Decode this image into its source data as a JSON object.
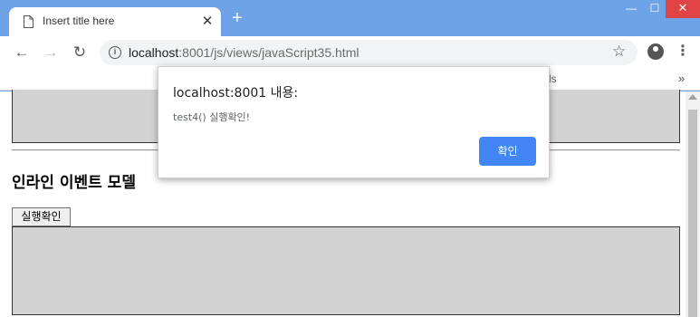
{
  "tab": {
    "title": "Insert title here",
    "close": "✕",
    "new_tab": "+"
  },
  "window_controls": {
    "minimize": "—",
    "maximize": "☐",
    "close": "✕"
  },
  "toolbar": {
    "back": "←",
    "forward": "→",
    "reload": "↻",
    "url_host": "localhost",
    "url_rest": ":8001/js/views/javaScript35.html",
    "star": "☆",
    "menu": "⋮"
  },
  "bookmarks": {
    "fragment": "ls",
    "more": "»"
  },
  "page": {
    "heading": "인라인 이벤트 모델",
    "exec_button": "실행확인"
  },
  "dialog": {
    "title": "localhost:8001 내용:",
    "message": "test4() 실행확인!",
    "ok": "확인"
  },
  "colors": {
    "chrome_blue": "#6ea3e8",
    "dialog_button": "#4285f4",
    "box_gray": "#d3d3d3",
    "close_red": "#e04343"
  }
}
